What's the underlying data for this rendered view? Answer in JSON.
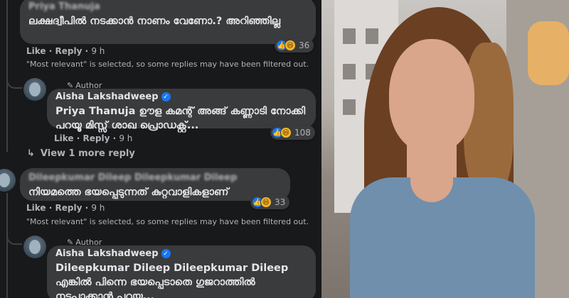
{
  "thread": {
    "comments": [
      {
        "author": "Priya Thanuja",
        "text": "ലക്ഷദ്വീപിൽ നടക്കാൻ നാണം വേണോ.? അറിഞ്ഞില്ല",
        "like_label": "Like",
        "reply_label": "Reply",
        "time": "9 h",
        "reaction_count": "36",
        "notice": "\"Most relevant\" is selected, so some replies may have been filtered out."
      },
      {
        "author": "Dileepkumar Dileep Dileepkumar Dileep",
        "text": "നിയമത്തെ ഭയപ്പെടുന്നത് കുറ്റവാളികളാണ്",
        "like_label": "Like",
        "reply_label": "Reply",
        "time": "9 h",
        "reaction_count": "33",
        "notice": "\"Most relevant\" is selected, so some replies may have been filtered out."
      }
    ],
    "replies": [
      {
        "author_badge": "Author",
        "author": "Aisha Lakshadweep",
        "tag": "Priya Thanuja",
        "text": "ഊള കമന്റ് അങ്ങ് കണ്ണാടി നോക്കി പറയൂ മിസ്സ് ശാഖ പ്രൊഡക്റ്റ്...",
        "like_label": "Like",
        "reply_label": "Reply",
        "time": "9 h",
        "reaction_count": "108"
      },
      {
        "author_badge": "Author",
        "author": "Aisha Lakshadweep",
        "tag": "Dileepkumar Dileep Dileepkumar Dileep",
        "text": "എങ്കിൽ പിന്നെ ഭയപ്പെടാതെ ഗുജറാത്തിൽ നടപ്പാക്കാൻ പറയൂ..."
      }
    ],
    "view_more": "View 1 more reply"
  },
  "icons": {
    "like": "👍",
    "haha": "😆",
    "reply_arrow": "↳",
    "author_pen": "✎",
    "verified": "✓"
  },
  "colors": {
    "background": "#18191a",
    "bubble": "#3a3b3c",
    "text": "#e4e6eb",
    "meta": "#b0b3b8",
    "fb_blue": "#1877f2"
  }
}
